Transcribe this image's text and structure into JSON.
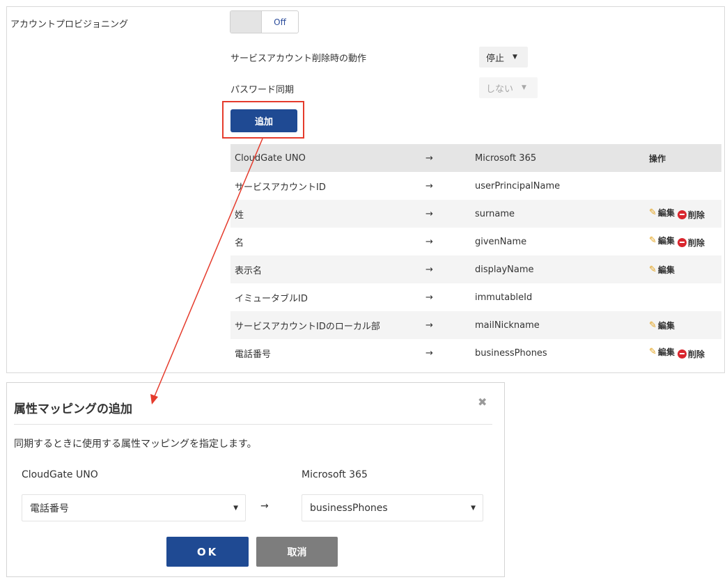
{
  "provisioning": {
    "label": "アカウントプロビジョニング",
    "toggle_state": "Off"
  },
  "settings": {
    "delete_action_label": "サービスアカウント削除時の動作",
    "delete_action_value": "停止",
    "password_sync_label": "パスワード同期",
    "password_sync_value": "しない",
    "caret": "▼"
  },
  "add_button_label": "追加",
  "mapping_table": {
    "headers": {
      "source": "CloudGate UNO",
      "arrow": "→",
      "target": "Microsoft 365",
      "ops": "操作"
    },
    "rows": [
      {
        "source": "サービスアカウントID",
        "arrow": "→",
        "target": "userPrincipalName"
      },
      {
        "source": "姓",
        "arrow": "→",
        "target": "surname",
        "edit": "編集",
        "delete": "削除"
      },
      {
        "source": "名",
        "arrow": "→",
        "target": "givenName",
        "edit": "編集",
        "delete": "削除"
      },
      {
        "source": "表示名",
        "arrow": "→",
        "target": "displayName",
        "edit": "編集"
      },
      {
        "source": "イミュータブルID",
        "arrow": "→",
        "target": "immutableId"
      },
      {
        "source": "サービスアカウントIDのローカル部",
        "arrow": "→",
        "target": "mailNickname",
        "edit": "編集"
      },
      {
        "source": "電話番号",
        "arrow": "→",
        "target": "businessPhones",
        "edit": "編集",
        "delete": "削除"
      }
    ]
  },
  "dialog": {
    "title": "属性マッピングの追加",
    "close": "✖",
    "description": "同期するときに使用する属性マッピングを指定します。",
    "source_label": "CloudGate UNO",
    "target_label": "Microsoft 365",
    "source_value": "電話番号",
    "target_value": "businessPhones",
    "arrow": "→",
    "ok_label": "OK",
    "cancel_label": "取消"
  },
  "colors": {
    "primary": "#1f4a93",
    "annotation": "#e53b2c",
    "cancel": "#7d7d7d",
    "delete": "#d9262e",
    "edit": "#e3a21a"
  }
}
